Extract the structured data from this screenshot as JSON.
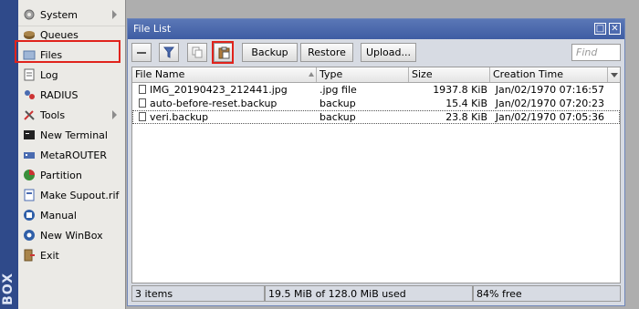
{
  "strip": {
    "text": "BOX"
  },
  "menu": {
    "items": [
      {
        "label": "System",
        "icon": "gear-icon",
        "has_submenu": true
      },
      {
        "label": "Queues",
        "icon": "queue-icon",
        "has_submenu": false
      },
      {
        "label": "Files",
        "icon": "folder-icon",
        "has_submenu": false
      },
      {
        "label": "Log",
        "icon": "log-icon",
        "has_submenu": false
      },
      {
        "label": "RADIUS",
        "icon": "radius-icon",
        "has_submenu": false
      },
      {
        "label": "Tools",
        "icon": "tools-icon",
        "has_submenu": true
      },
      {
        "label": "New Terminal",
        "icon": "terminal-icon",
        "has_submenu": false
      },
      {
        "label": "MetaROUTER",
        "icon": "metarouter-icon",
        "has_submenu": false
      },
      {
        "label": "Partition",
        "icon": "partition-icon",
        "has_submenu": false
      },
      {
        "label": "Make Supout.rif",
        "icon": "supout-icon",
        "has_submenu": false
      },
      {
        "label": "Manual",
        "icon": "manual-icon",
        "has_submenu": false
      },
      {
        "label": "New WinBox",
        "icon": "winbox-icon",
        "has_submenu": false
      },
      {
        "label": "Exit",
        "icon": "exit-icon",
        "has_submenu": false
      }
    ]
  },
  "window": {
    "title": "File List",
    "toolbar": {
      "backup_label": "Backup",
      "restore_label": "Restore",
      "upload_label": "Upload...",
      "find_placeholder": "Find"
    },
    "columns": [
      "File Name",
      "Type",
      "Size",
      "Creation Time"
    ],
    "rows": [
      {
        "name": "IMG_20190423_212441.jpg",
        "type": ".jpg file",
        "size": "1937.8 KiB",
        "time": "Jan/02/1970 07:16:57"
      },
      {
        "name": "auto-before-reset.backup",
        "type": "backup",
        "size": "15.4 KiB",
        "time": "Jan/02/1970 07:20:23"
      },
      {
        "name": "veri.backup",
        "type": "backup",
        "size": "23.8 KiB",
        "time": "Jan/02/1970 07:05:36"
      }
    ],
    "status": {
      "items": "3 items",
      "usage": "19.5 MiB of 128.0 MiB used",
      "free": "84% free"
    }
  },
  "colors": {
    "accent": "#3f5da3",
    "highlight": "#e0231c",
    "strip": "#2f4a8a"
  }
}
